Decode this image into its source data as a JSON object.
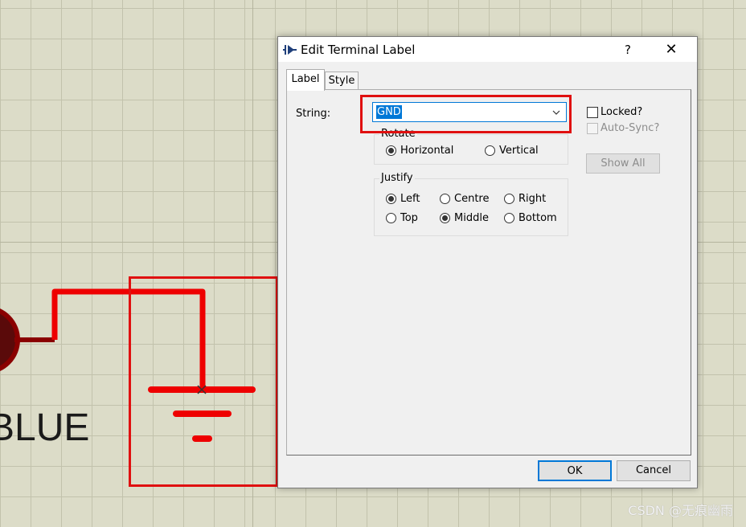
{
  "canvas": {
    "led_label": "BLUE",
    "watermark": "CSDN @无痕幽雨"
  },
  "dialog": {
    "title": "Edit Terminal Label",
    "help_label": "?",
    "close_label": "✕",
    "tabs": [
      {
        "label": "Label",
        "active": true
      },
      {
        "label": "Style",
        "active": false
      }
    ],
    "string": {
      "label": "String:",
      "value": "GND"
    },
    "rotate": {
      "title": "Rotate",
      "options": [
        {
          "label": "Horizontal",
          "checked": true
        },
        {
          "label": "Vertical",
          "checked": false
        }
      ]
    },
    "justify": {
      "title": "Justify",
      "options": [
        {
          "label": "Left",
          "checked": true
        },
        {
          "label": "Centre",
          "checked": false
        },
        {
          "label": "Right",
          "checked": false
        },
        {
          "label": "Top",
          "checked": false
        },
        {
          "label": "Middle",
          "checked": true
        },
        {
          "label": "Bottom",
          "checked": false
        }
      ]
    },
    "locked_label": "Locked?",
    "auto_sync_label": "Auto-Sync?",
    "show_all_label": "Show All",
    "ok_label": "OK",
    "cancel_label": "Cancel"
  },
  "colors": {
    "highlight": "#e01010",
    "wire": "#ee0000",
    "selection": "#0078d7"
  }
}
